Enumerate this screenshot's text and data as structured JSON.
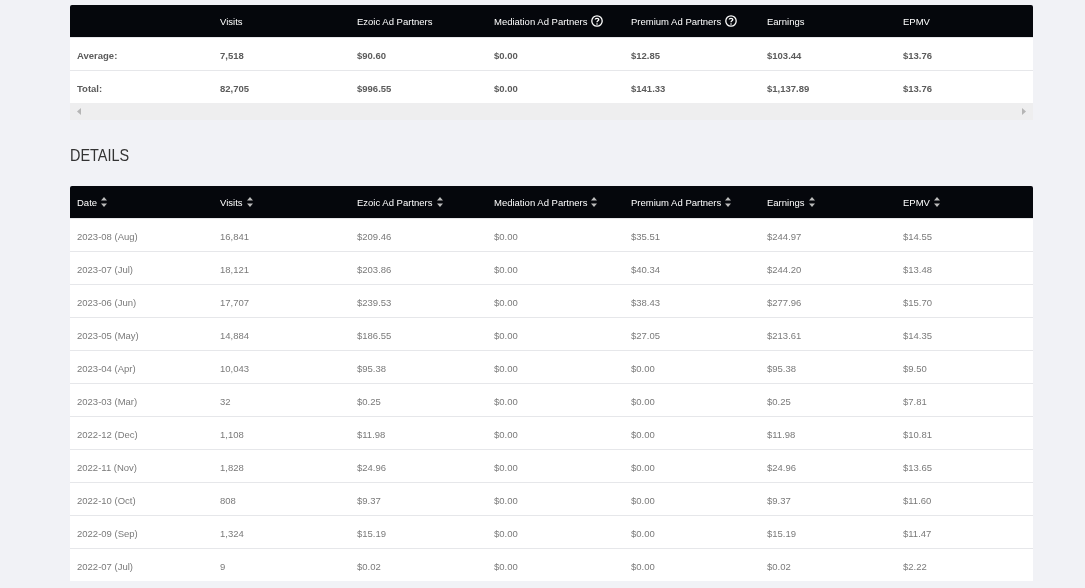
{
  "summary": {
    "columns": [
      {
        "label": "Visits",
        "help": false
      },
      {
        "label": "Ezoic Ad Partners",
        "help": false
      },
      {
        "label": "Mediation Ad Partners",
        "help": true
      },
      {
        "label": "Premium Ad Partners",
        "help": true
      },
      {
        "label": "Earnings",
        "help": false
      },
      {
        "label": "EPMV",
        "help": false
      }
    ],
    "rows": [
      {
        "label": "Average:",
        "cells": [
          "7,518",
          "$90.60",
          "$0.00",
          "$12.85",
          "$103.44",
          "$13.76"
        ]
      },
      {
        "label": "Total:",
        "cells": [
          "82,705",
          "$996.55",
          "$0.00",
          "$141.33",
          "$1,137.89",
          "$13.76"
        ]
      }
    ]
  },
  "details": {
    "title": "DETAILS",
    "columns": [
      "Date",
      "Visits",
      "Ezoic Ad Partners",
      "Mediation Ad Partners",
      "Premium Ad Partners",
      "Earnings",
      "EPMV"
    ],
    "rows": [
      [
        "2023-08 (Aug)",
        "16,841",
        "$209.46",
        "$0.00",
        "$35.51",
        "$244.97",
        "$14.55"
      ],
      [
        "2023-07 (Jul)",
        "18,121",
        "$203.86",
        "$0.00",
        "$40.34",
        "$244.20",
        "$13.48"
      ],
      [
        "2023-06 (Jun)",
        "17,707",
        "$239.53",
        "$0.00",
        "$38.43",
        "$277.96",
        "$15.70"
      ],
      [
        "2023-05 (May)",
        "14,884",
        "$186.55",
        "$0.00",
        "$27.05",
        "$213.61",
        "$14.35"
      ],
      [
        "2023-04 (Apr)",
        "10,043",
        "$95.38",
        "$0.00",
        "$0.00",
        "$95.38",
        "$9.50"
      ],
      [
        "2023-03 (Mar)",
        "32",
        "$0.25",
        "$0.00",
        "$0.00",
        "$0.25",
        "$7.81"
      ],
      [
        "2022-12 (Dec)",
        "1,108",
        "$11.98",
        "$0.00",
        "$0.00",
        "$11.98",
        "$10.81"
      ],
      [
        "2022-11 (Nov)",
        "1,828",
        "$24.96",
        "$0.00",
        "$0.00",
        "$24.96",
        "$13.65"
      ],
      [
        "2022-10 (Oct)",
        "808",
        "$9.37",
        "$0.00",
        "$0.00",
        "$9.37",
        "$11.60"
      ],
      [
        "2022-09 (Sep)",
        "1,324",
        "$15.19",
        "$0.00",
        "$0.00",
        "$15.19",
        "$11.47"
      ],
      [
        "2022-07 (Jul)",
        "9",
        "$0.02",
        "$0.00",
        "$0.00",
        "$0.02",
        "$2.22"
      ]
    ]
  }
}
